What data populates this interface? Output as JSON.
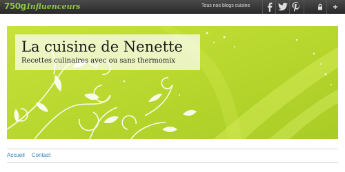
{
  "topbar": {
    "logo_number": "750g",
    "logo_text": "Influenceurs",
    "blogs_link": "Tous nos blogs cuisine",
    "icons": [
      "facebook-icon",
      "twitter-icon",
      "pinterest-icon",
      "lock-icon",
      "plus-icon"
    ]
  },
  "header": {
    "title": "La cuisine de Nenette",
    "tagline": "Recettes culinaires avec ou sans thermomix"
  },
  "nav": {
    "items": [
      "Accueil",
      "Contact"
    ]
  },
  "colors": {
    "header_green": "#b9d832",
    "logo_green": "#8cc63f",
    "link_blue": "#2a7fb0",
    "topbar_dark": "#2b2b2b"
  }
}
